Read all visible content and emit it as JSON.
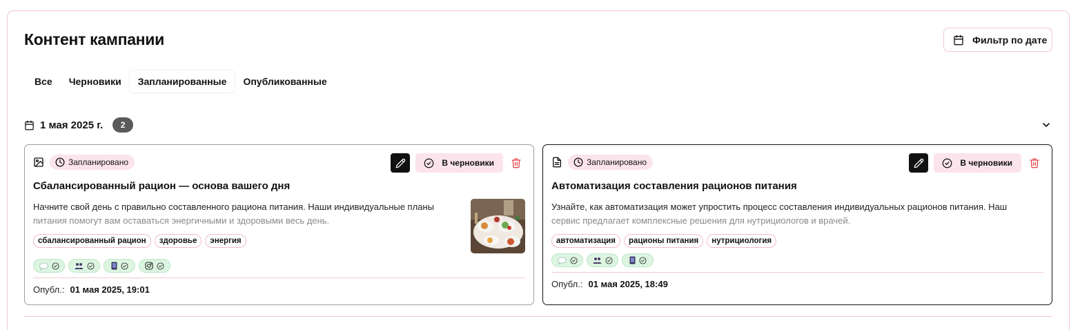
{
  "page": {
    "title": "Контент кампании",
    "filter_button_label": "Фильтр по дате"
  },
  "tabs": [
    {
      "label": "Все",
      "active": false
    },
    {
      "label": "Черновики",
      "active": false
    },
    {
      "label": "Запланированные",
      "active": true
    },
    {
      "label": "Опубликованные",
      "active": false
    }
  ],
  "date_group": {
    "label": "1 мая 2025 г.",
    "count": "2"
  },
  "cards": [
    {
      "type_icon": "image-icon",
      "status": "Запланировано",
      "move_to_drafts_label": "В черновики",
      "title": "Сбалансированный рацион — основа вашего дня",
      "description_line1": "Начните свой день с правильно составленного рациона питания. Наши индивидуальные планы",
      "description_line2": "питания помогут вам оставаться энергичными и здоровыми весь день.",
      "tags": [
        "сбалансированный рацион",
        "здоровье",
        "энергия"
      ],
      "channels": [
        "chat-icon",
        "group-icon",
        "phone-icon",
        "instagram-icon"
      ],
      "published_label": "Опубл.:",
      "published_value": "01 мая 2025, 19:01"
    },
    {
      "type_icon": "document-icon",
      "status": "Запланировано",
      "move_to_drafts_label": "В черновики",
      "title": "Автоматизация составления рационов питания",
      "description_line1": "Узнайте, как автоматизация может упростить процесс составления индивидуальных рационов питания. Наш",
      "description_line2": "сервис предлагает комплексные решения для нутрициологов и врачей.",
      "tags": [
        "автоматизация",
        "рационы питания",
        "нутрициология"
      ],
      "channels": [
        "chat-icon",
        "group-icon",
        "phone-icon"
      ],
      "published_label": "Опубл.:",
      "published_value": "01 мая 2025, 18:49"
    }
  ],
  "colors": {
    "border_pink": "#f3c6d3",
    "pill_pink": "#fce4ec",
    "channel_green": "#dcf5e1",
    "trash_red": "#e5484d"
  }
}
